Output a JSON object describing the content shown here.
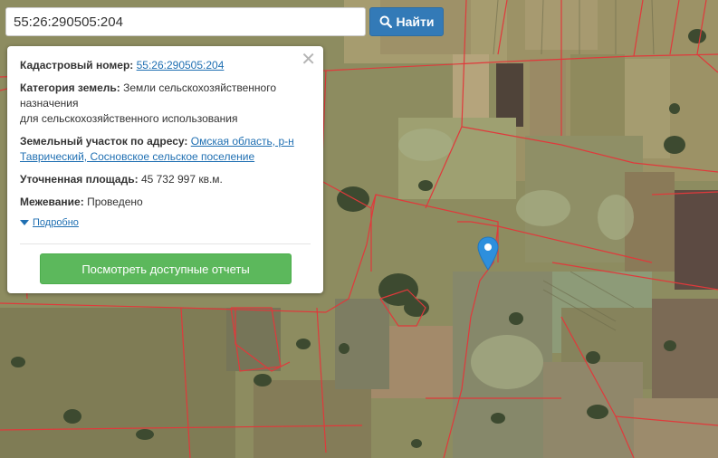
{
  "search": {
    "value": "55:26:290505:204",
    "button_label": "Найти",
    "button_icon": "search-icon"
  },
  "popup": {
    "cadastral_label": "Кадастровый номер:",
    "cadastral_value": "55:26:290505:204",
    "category_label": "Категория земель:",
    "category_line1": "Земли сельскохозяйственного",
    "category_line2": "назначения",
    "category_line3": "для сельскохозяйственного использования",
    "address_label": "Земельный участок по адресу:",
    "address_part1": "Омская область, р-н",
    "address_part2": "Таврический, Сосновское сельское поселение",
    "area_label": "Уточненная площадь:",
    "area_value": "45 732 997 кв.м.",
    "survey_label": "Межевание:",
    "survey_value": "Проведено",
    "more_label": "Подробно",
    "reports_button": "Посмотреть доступные отчеты",
    "close_icon": "close-icon"
  },
  "map": {
    "type": "satellite",
    "boundary_color": "#e0393b",
    "marker_color": "#2d8fdd",
    "marker_icon": "map-pin-icon"
  }
}
